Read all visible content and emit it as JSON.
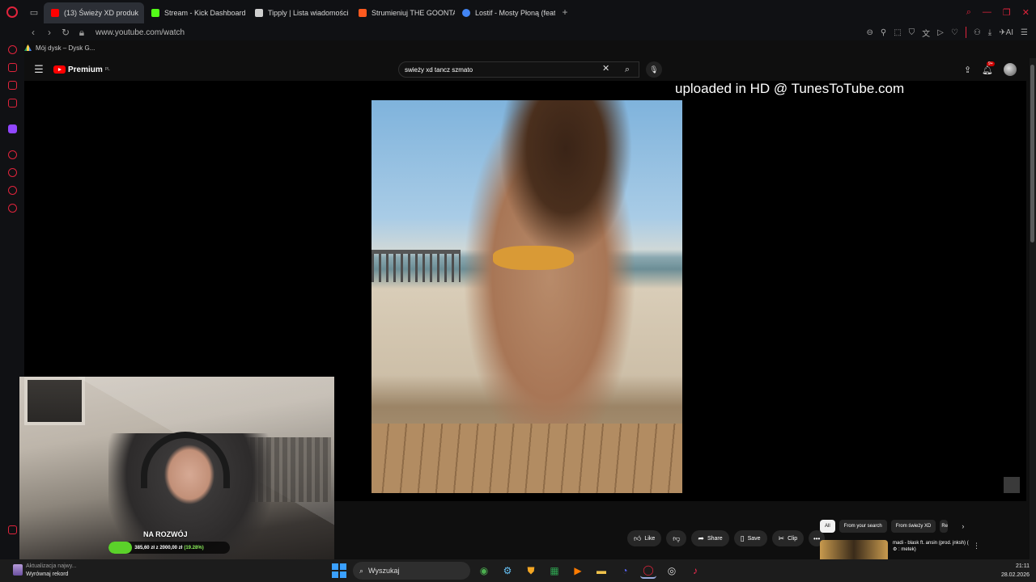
{
  "browser": {
    "tabs": [
      {
        "label": "(13) Świeży XD produk",
        "favicon_color": "#ff0000",
        "active": true
      },
      {
        "label": "Stream - Kick Dashboard",
        "favicon_color": "#53fc18",
        "active": false
      },
      {
        "label": "Tipply | Lista wiadomości",
        "favicon_color": "#cfcfcf",
        "active": false
      },
      {
        "label": "Strumieniuj THE GOONTA",
        "favicon_color": "#ff5a1f",
        "active": false
      },
      {
        "label": "Lostif - Mosty Płoną (feat.",
        "favicon_color": "#4285f4",
        "active": false
      }
    ],
    "new_tab_label": "+",
    "url": "www.youtube.com/watch",
    "bookmark": "Mój dysk – Dysk G..."
  },
  "youtube": {
    "logo_text": "Premium",
    "logo_region": "PL",
    "search_value": "swieży xd tancz szmato",
    "notifications_badge": "9+",
    "watermark": "uploaded in HD @ TunesToTube.com",
    "actions": {
      "like": "Like",
      "share": "Share",
      "save": "Save",
      "clip": "Clip"
    },
    "filters": [
      "All",
      "From your search",
      "From świeży XD",
      "Re"
    ],
    "recommended": {
      "title": "madi - blask ft. ansin (prod. jnksh) ( ⚙ : metek)"
    }
  },
  "overlay": {
    "goal_title": "NA ROZWÓJ",
    "goal_amount": "385,60 zł z 2000,00 zł",
    "goal_percent": "(19.28%)",
    "goal_fraction": 0.1928,
    "accent_color": "#5bd12a"
  },
  "taskbar": {
    "notification_line1": "Aktualizacja najwy...",
    "notification_line2": "Wyrównaj rekord",
    "search_placeholder": "Wyszukaj",
    "time": "21:11",
    "date": "28.02.2026"
  }
}
